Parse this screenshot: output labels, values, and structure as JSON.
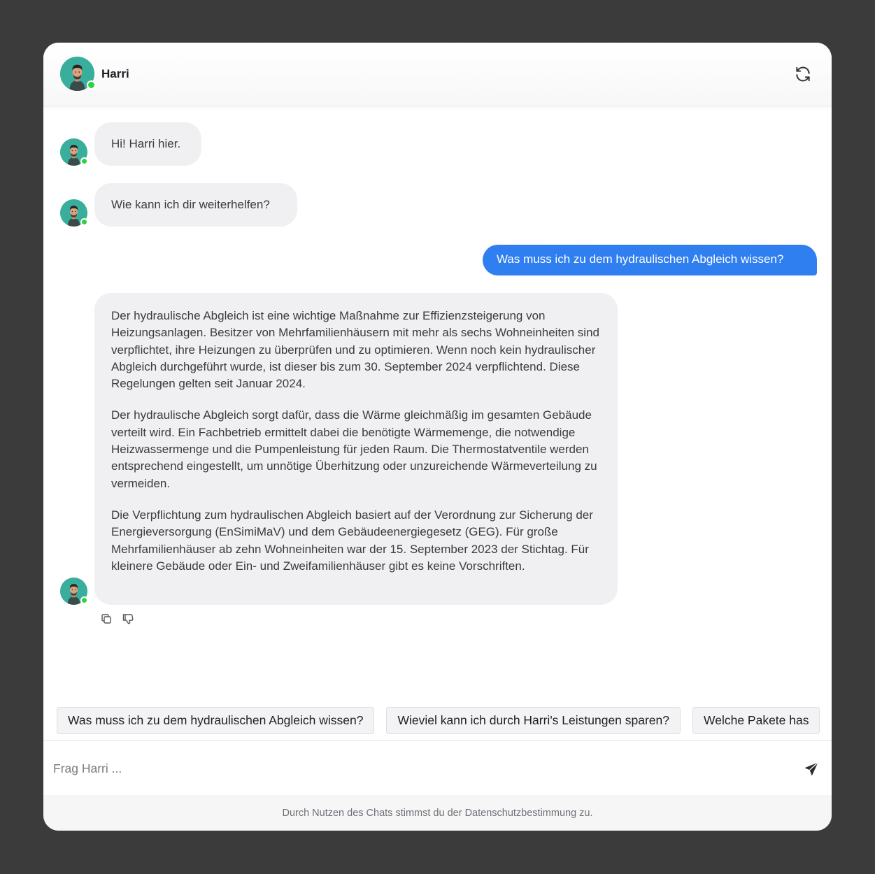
{
  "header": {
    "name": "Harri",
    "avatar_icon": "person-avatar-icon",
    "refresh_icon": "refresh-icon"
  },
  "messages": [
    {
      "role": "bot",
      "text": "Hi! Harri hier."
    },
    {
      "role": "bot",
      "text": "Wie kann ich dir weiterhelfen?"
    },
    {
      "role": "user",
      "text": "Was muss ich zu dem hydraulischen Abgleich wissen?"
    },
    {
      "role": "bot",
      "paragraphs": [
        "Der hydraulische Abgleich ist eine wichtige Maßnahme zur Effizienzsteigerung von Heizungsanlagen. Besitzer von Mehrfamilienhäusern mit mehr als sechs Wohneinheiten sind verpflichtet, ihre Heizungen zu überprüfen und zu optimieren. Wenn noch kein hydraulischer Abgleich durchgeführt wurde, ist dieser bis zum 30. September 2024 verpflichtend. Diese Regelungen gelten seit Januar 2024.",
        "Der hydraulische Abgleich sorgt dafür, dass die Wärme gleichmäßig im gesamten Gebäude verteilt wird. Ein Fachbetrieb ermittelt dabei die benötigte Wärmemenge, die notwendige Heizwassermenge und die Pumpenleistung für jeden Raum. Die Thermostatventile werden entsprechend eingestellt, um unnötige Überhitzung oder unzureichende Wärmeverteilung zu vermeiden.",
        "Die Verpflichtung zum hydraulischen Abgleich basiert auf der Verordnung zur Sicherung der Energieversorgung (EnSimiMaV) und dem Gebäudeenergiegesetz (GEG). Für große Mehrfamilienhäuser ab zehn Wohneinheiten war der 15. September 2023 der Stichtag. Für kleinere Gebäude oder Ein- und Zweifamilienhäuser gibt es keine Vorschriften."
      ]
    }
  ],
  "message_actions": {
    "copy_icon": "copy-icon",
    "dislike_icon": "thumbs-down-icon"
  },
  "suggestions": [
    "Was muss ich zu dem hydraulischen Abgleich wissen?",
    "Wieviel kann ich durch Harri's Leistungen sparen?",
    "Welche Pakete has"
  ],
  "input": {
    "placeholder": "Frag Harri ...",
    "value": "",
    "send_icon": "send-icon"
  },
  "footer": {
    "text": "Durch Nutzen des Chats stimmst du der Datenschutzbestimmung zu."
  },
  "colors": {
    "accent": "#2f7ff0",
    "avatar_bg": "#3aae9c",
    "online": "#2ad43c",
    "bubble_bg": "#f0f0f2",
    "page_bg": "#3b3b3b"
  }
}
